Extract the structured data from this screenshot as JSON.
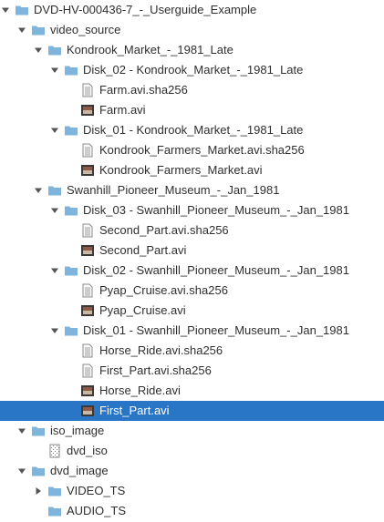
{
  "tree": [
    {
      "label": "DVD-HV-000436-7_-_Userguide_Example",
      "type": "folder",
      "depth": 0,
      "expanded": true
    },
    {
      "label": "video_source",
      "type": "folder",
      "depth": 1,
      "expanded": true
    },
    {
      "label": "Kondrook_Market_-_1981_Late",
      "type": "folder",
      "depth": 2,
      "expanded": true
    },
    {
      "label": "Disk_02 - Kondrook_Market_-_1981_Late",
      "type": "folder",
      "depth": 3,
      "expanded": true
    },
    {
      "label": "Farm.avi.sha256",
      "type": "text-file",
      "depth": 4
    },
    {
      "label": "Farm.avi",
      "type": "video-file",
      "depth": 4
    },
    {
      "label": "Disk_01 - Kondrook_Market_-_1981_Late",
      "type": "folder",
      "depth": 3,
      "expanded": true
    },
    {
      "label": "Kondrook_Farmers_Market.avi.sha256",
      "type": "text-file",
      "depth": 4
    },
    {
      "label": "Kondrook_Farmers_Market.avi",
      "type": "video-file",
      "depth": 4
    },
    {
      "label": "Swanhill_Pioneer_Museum_-_Jan_1981",
      "type": "folder",
      "depth": 2,
      "expanded": true
    },
    {
      "label": "Disk_03 - Swanhill_Pioneer_Museum_-_Jan_1981",
      "type": "folder",
      "depth": 3,
      "expanded": true
    },
    {
      "label": "Second_Part.avi.sha256",
      "type": "text-file",
      "depth": 4
    },
    {
      "label": "Second_Part.avi",
      "type": "video-file",
      "depth": 4
    },
    {
      "label": "Disk_02 - Swanhill_Pioneer_Museum_-_Jan_1981",
      "type": "folder",
      "depth": 3,
      "expanded": true
    },
    {
      "label": "Pyap_Cruise.avi.sha256",
      "type": "text-file",
      "depth": 4
    },
    {
      "label": "Pyap_Cruise.avi",
      "type": "video-file",
      "depth": 4
    },
    {
      "label": "Disk_01 - Swanhill_Pioneer_Museum_-_Jan_1981",
      "type": "folder",
      "depth": 3,
      "expanded": true
    },
    {
      "label": "Horse_Ride.avi.sha256",
      "type": "text-file",
      "depth": 4
    },
    {
      "label": "First_Part.avi.sha256",
      "type": "text-file",
      "depth": 4
    },
    {
      "label": "Horse_Ride.avi",
      "type": "video-file",
      "depth": 4
    },
    {
      "label": "First_Part.avi",
      "type": "video-file",
      "depth": 4,
      "selected": true
    },
    {
      "label": "iso_image",
      "type": "folder",
      "depth": 1,
      "expanded": true
    },
    {
      "label": "dvd_iso",
      "type": "iso-file",
      "depth": 2
    },
    {
      "label": "dvd_image",
      "type": "folder",
      "depth": 1,
      "expanded": true
    },
    {
      "label": "VIDEO_TS",
      "type": "folder",
      "depth": 2,
      "expanded": false
    },
    {
      "label": "AUDIO_TS",
      "type": "folder",
      "depth": 2,
      "leaf": true
    }
  ],
  "colors": {
    "selection": "#2a76c6",
    "folder": "#7fb5dd",
    "arrow": "#555555"
  }
}
